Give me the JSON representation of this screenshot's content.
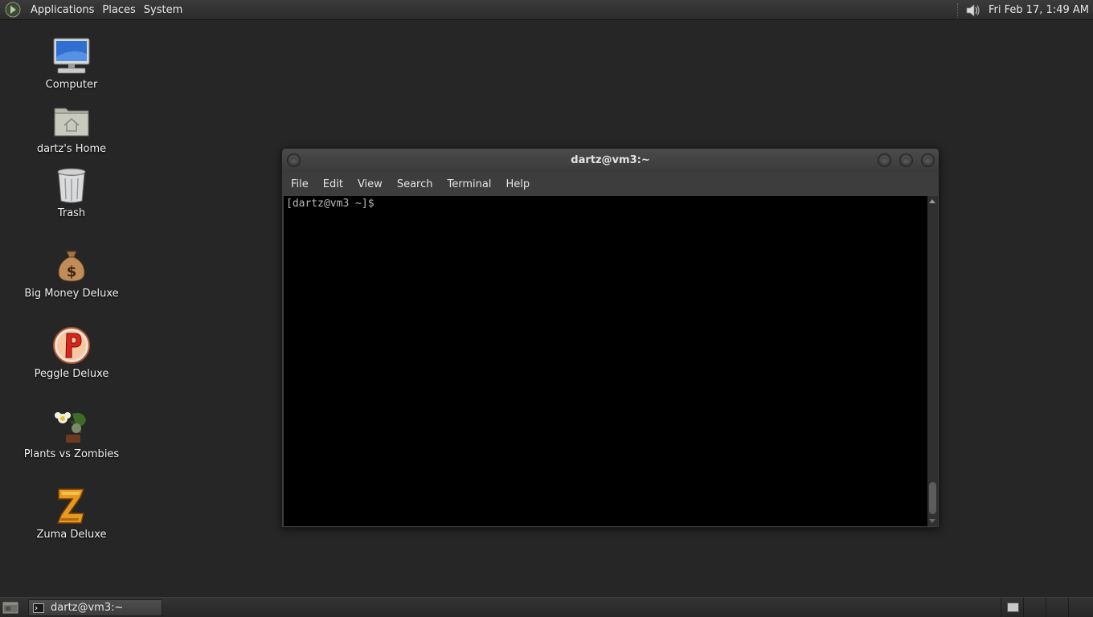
{
  "top_panel": {
    "menu": [
      "Applications",
      "Places",
      "System"
    ],
    "clock": "Fri Feb 17,  1:49 AM",
    "icons": [
      "gnome-foot-logo-icon",
      "volume-icon"
    ]
  },
  "desktop": {
    "icons": [
      {
        "label": "Computer",
        "icon": "computer-icon"
      },
      {
        "label": "dartz's Home",
        "icon": "home-folder-icon"
      },
      {
        "label": "Trash",
        "icon": "trash-icon"
      },
      {
        "label": "Big Money Deluxe",
        "icon": "money-bag-icon"
      },
      {
        "label": "Peggle Deluxe",
        "icon": "peggle-icon"
      },
      {
        "label": "Plants vs Zombies",
        "icon": "plants-vs-zombies-icon"
      },
      {
        "label": "Zuma Deluxe",
        "icon": "zuma-icon"
      }
    ]
  },
  "terminal": {
    "title": "dartz@vm3:~",
    "menu": [
      "File",
      "Edit",
      "View",
      "Search",
      "Terminal",
      "Help"
    ],
    "prompt": "[dartz@vm3 ~]$ ",
    "scroll_position": 1.0
  },
  "bottom_panel": {
    "task_label": "dartz@vm3:~",
    "workspaces": 4,
    "active_workspace": 1
  },
  "colors": {
    "desktop_bg": "#252625",
    "panel_bg": "#2f302f",
    "terminal_bg": "#000000",
    "prompt_text": "#b8b8b8"
  }
}
